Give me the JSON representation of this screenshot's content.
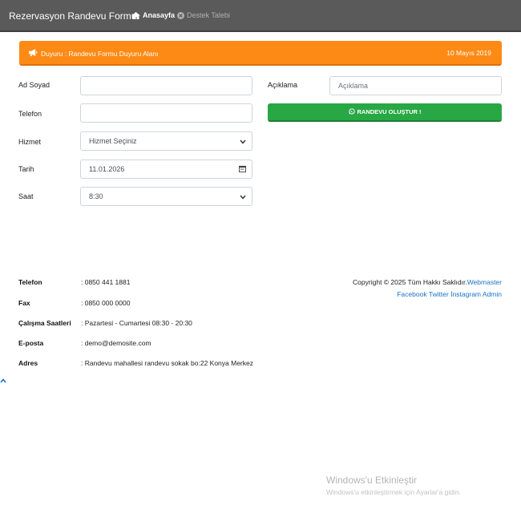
{
  "navbar": {
    "brand": "Rezervasyon Randevu Formu",
    "home_label": "Anasayfa",
    "support_label": "Destek Talebi"
  },
  "announcement": {
    "text": "Duyuru : Randevu Formu Duyuru Alanı",
    "date": "10 Mayıs 2019",
    "color": "#fd8a15"
  },
  "form": {
    "name_label": "Ad Soyad",
    "name_value": "",
    "phone_label": "Telefon",
    "phone_value": "",
    "service_label": "Hizmet",
    "service_selected": "Hizmet Seçiniz",
    "date_label": "Tarih",
    "date_value": "11.01.2026",
    "time_label": "Saat",
    "time_selected": "8:30",
    "description_label": "Açıklama",
    "description_placeholder": "Açıklama",
    "submit_label": "RANDEVU OLUŞTUR !",
    "submit_color": "#28a745"
  },
  "contact": {
    "items": [
      {
        "label": "Telefon",
        "value": ": 0850 441 1881"
      },
      {
        "label": "Fax",
        "value": ": 0850 000 0000"
      },
      {
        "label": "Çalışma Saatleri",
        "value": ": Pazartesi - Cumartesi 08:30 - 20:30"
      },
      {
        "label": "E-posta",
        "value": ": demo@demosite.com"
      },
      {
        "label": "Adres",
        "value": ": Randevu mahallesi randevu sokak bo:22 Konya Merkez"
      }
    ]
  },
  "footer": {
    "copyright": "Copyright © 2025 Tüm Hakkı Saklıdır.",
    "webmaster": "Webmaster",
    "links": [
      "Facebook",
      "Twitter",
      "İnstagram",
      "Admin"
    ]
  },
  "watermark": {
    "title": "Windows'u Etkinleştir",
    "subtitle": "Windows'u etkinleştirmek için Ayarlar'a gidin."
  }
}
